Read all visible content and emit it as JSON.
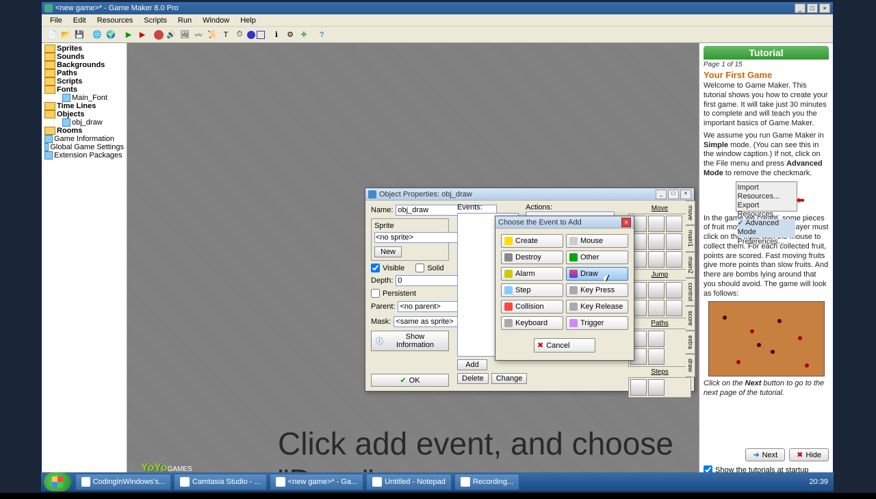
{
  "app": {
    "title": "<new game>* - Game Maker 8.0 Pro",
    "menus": [
      "File",
      "Edit",
      "Resources",
      "Scripts",
      "Run",
      "Window",
      "Help"
    ]
  },
  "tree": {
    "folders": [
      "Sprites",
      "Sounds",
      "Backgrounds",
      "Paths",
      "Scripts",
      "Fonts",
      "Time Lines",
      "Objects",
      "Rooms"
    ],
    "font_item": "Main_Font",
    "object_item": "obj_draw",
    "extras": [
      "Game Information",
      "Global Game Settings",
      "Extension Packages"
    ]
  },
  "obj_dialog": {
    "title": "Object Properties: obj_draw",
    "name_label": "Name:",
    "name_value": "obj_draw",
    "sprite_label": "Sprite",
    "sprite_value": "<no sprite>",
    "new_btn": "New",
    "visible": "Visible",
    "solid": "Solid",
    "depth_label": "Depth:",
    "depth_value": "0",
    "persistent": "Persistent",
    "parent_label": "Parent:",
    "parent_value": "<no parent>",
    "mask_label": "Mask:",
    "mask_value": "<same as sprite>",
    "show_info": "Show Information",
    "ok": "OK",
    "events_hdr": "Events:",
    "actions_hdr": "Actions:",
    "add_btn": "Add",
    "delete_btn": "Delete",
    "change_btn": "Change",
    "palette_sections": [
      "Move",
      "Jump",
      "Paths",
      "Steps"
    ],
    "tabs": [
      "move",
      "main1",
      "main2",
      "control",
      "score",
      "extra",
      "draw"
    ]
  },
  "event_dialog": {
    "title": "Choose the Event to Add",
    "events_left": [
      "Create",
      "Destroy",
      "Alarm",
      "Step",
      "Collision",
      "Keyboard"
    ],
    "events_right": [
      "Mouse",
      "Other",
      "Draw",
      "Key Press",
      "Key Release",
      "Trigger"
    ],
    "cancel": "Cancel"
  },
  "tutorial": {
    "header": "Tutorial",
    "page": "Page 1 of 15",
    "title": "Your First Game",
    "p1": "Welcome to Game Maker. This tutorial shows you how to create your first game. It will take just 30 minutes to complete and will teach you the important basics of Game Maker.",
    "p2a": "We assume you run Game Maker in ",
    "p2b": "Simple",
    "p2c": " mode. (You can see this in the window caption.) If not, click on the File menu and press ",
    "p2d": "Advanced Mode",
    "p2e": " to remove the checkmark.",
    "menu_items": [
      "Import Resources...",
      "Export Resources...",
      "Advanced Mode",
      "Preferences..."
    ],
    "p3": "In the game we create, some pieces of fruit move around. The player must click on the fruits with the mouse to collect them. For each collected fruit, points are scored. Fast moving fruits give more points than slow fruits. And there are bombs lying around that you should avoid. The game will look as follows:",
    "p4a": "Click on the ",
    "p4b": "Next",
    "p4c": " button to go to the next page of the tutorial.",
    "next_btn": "Next",
    "hide_btn": "Hide",
    "show_startup": "Show the tutorials at startup"
  },
  "caption": "Click add event, and choose \"Draw\"",
  "taskbar": {
    "items": [
      "CodingInWindows's...",
      "Camtasia Studio - ...",
      "<new game>* - Ga...",
      "Untitled - Notepad",
      "Recording..."
    ],
    "time": "20:39"
  }
}
